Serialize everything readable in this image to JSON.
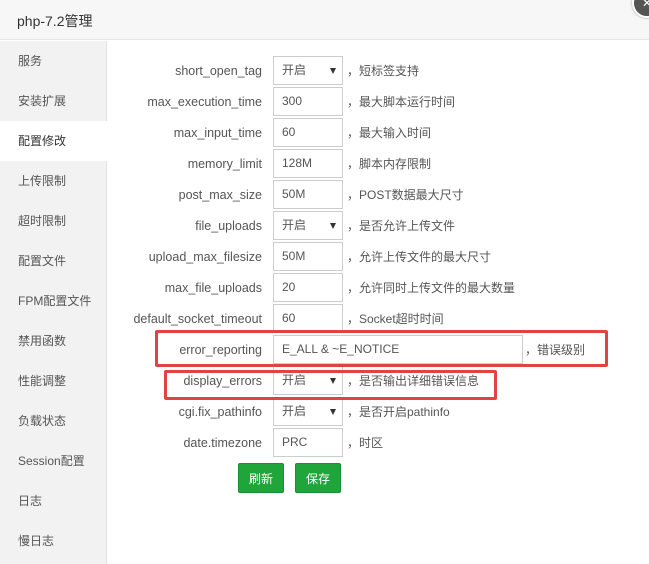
{
  "window": {
    "title": "php-7.2管理",
    "close_glyph": "✕"
  },
  "sidebar": {
    "items": [
      {
        "label": "服务"
      },
      {
        "label": "安装扩展"
      },
      {
        "label": "配置修改"
      },
      {
        "label": "上传限制"
      },
      {
        "label": "超时限制"
      },
      {
        "label": "配置文件"
      },
      {
        "label": "FPM配置文件"
      },
      {
        "label": "禁用函数"
      },
      {
        "label": "性能调整"
      },
      {
        "label": "负载状态"
      },
      {
        "label": "Session配置"
      },
      {
        "label": "日志"
      },
      {
        "label": "慢日志"
      }
    ],
    "active_label": "配置修改"
  },
  "config": {
    "short_open_tag": {
      "label": "short_open_tag",
      "value": "开启",
      "note": "，短标签支持"
    },
    "max_execution_time": {
      "label": "max_execution_time",
      "value": "300",
      "note": "，最大脚本运行时间"
    },
    "max_input_time": {
      "label": "max_input_time",
      "value": "60",
      "note": "，最大输入时间"
    },
    "memory_limit": {
      "label": "memory_limit",
      "value": "128M",
      "note": "，脚本内存限制"
    },
    "post_max_size": {
      "label": "post_max_size",
      "value": "50M",
      "note": "，POST数据最大尺寸"
    },
    "file_uploads": {
      "label": "file_uploads",
      "value": "开启",
      "note": "，是否允许上传文件"
    },
    "upload_max_filesize": {
      "label": "upload_max_filesize",
      "value": "50M",
      "note": "，允许上传文件的最大尺寸"
    },
    "max_file_uploads": {
      "label": "max_file_uploads",
      "value": "20",
      "note": "，允许同时上传文件的最大数量"
    },
    "default_socket_timeout": {
      "label": "default_socket_timeout",
      "value": "60",
      "note": "，Socket超时时间"
    },
    "error_reporting": {
      "label": "error_reporting",
      "value": "E_ALL & ~E_NOTICE",
      "note": "，错误级别"
    },
    "display_errors": {
      "label": "display_errors",
      "value": "开启",
      "note": "，是否输出详细错误信息"
    },
    "cgi_fix_pathinfo": {
      "label": "cgi.fix_pathinfo",
      "value": "开启",
      "note": "，是否开启pathinfo"
    },
    "date_timezone": {
      "label": "date.timezone",
      "value": "PRC",
      "note": "，时区"
    }
  },
  "buttons": {
    "refresh": "刷新",
    "save": "保存"
  },
  "colors": {
    "accent_green": "#20a53a",
    "highlight_red": "#e14242"
  }
}
